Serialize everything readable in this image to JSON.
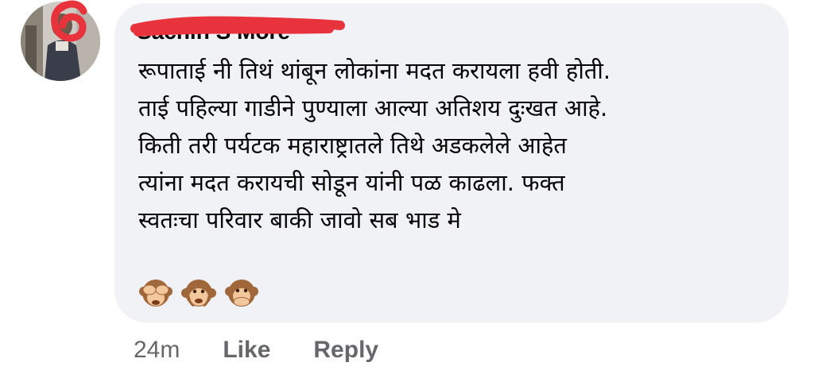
{
  "comment": {
    "author": "Sachin S More",
    "lines": [
      "रूपाताई नी तिथं थांबून लोकांना मदत करायला हवी होती.",
      "ताई पहिल्या गाडीने पुण्याला आल्या अतिशय दुःखत आहे.",
      "किती तरी पर्यटक महाराष्ट्रातले तिथे अडकलेले आहेत",
      "त्यांना मदत करायची सोडून यांनी पळ काढला. फक्त",
      "स्वतःचा परिवार बाकी जावो सब भाड मे"
    ],
    "emojis": [
      "see-no-evil-monkey",
      "monkey-face",
      "speak-no-evil-monkey"
    ]
  },
  "actions": {
    "timestamp": "24m",
    "like_label": "Like",
    "reply_label": "Reply"
  },
  "colors": {
    "bubble": "#f0f2f5",
    "meta_text": "#65676b",
    "redaction": "#e8323c"
  }
}
